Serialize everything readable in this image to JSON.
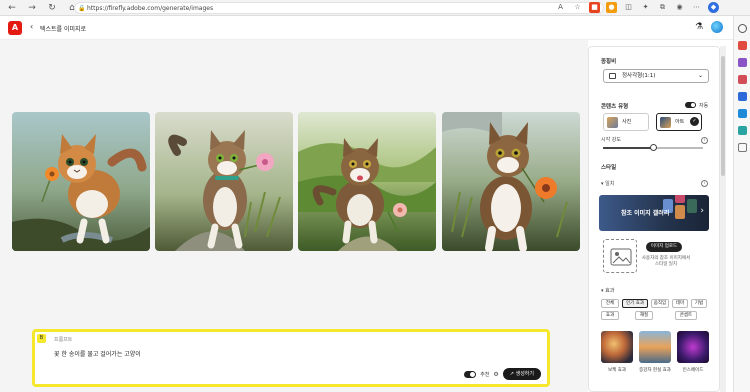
{
  "browser": {
    "url": "https://firefly.adobe.com/generate/images",
    "nav_back": "←",
    "nav_forward": "→",
    "nav_reload": "↻",
    "nav_home": "⌂",
    "lock_icon": "🔒"
  },
  "app": {
    "logo_letter": "A",
    "back_arrow": "‹",
    "title": "텍스트를 이미지로",
    "flask_icon": "⚗"
  },
  "prompt": {
    "chip": "B",
    "label": "프롬프트",
    "text": "꽃 한 송이를 물고 걸어가는 고양이",
    "toggle_label": "추천",
    "settings_icon": "⚙",
    "generate_label": "생성하기",
    "generate_icon": "↗"
  },
  "panel": {
    "aspect_label": "종횡비",
    "aspect_value": "정사각형(1:1)",
    "content_type_label": "콘텐츠 유형",
    "auto_label": "자동",
    "photo_label": "사진",
    "art_label": "아트",
    "visual_intensity_label": "시각 강도",
    "visual_intensity_value": 0.5,
    "style_label": "스타일",
    "match_label": "일치",
    "gallery_label": "참조 이미지 갤러리",
    "upload_label": "이미지 업로드",
    "upload_desc": "사용자의 참조 이미지에서 스타일 일치",
    "effects_label": "효과",
    "effect_tabs": [
      "전체",
      "인기 효과",
      "움직임",
      "테마",
      "기법",
      "효과",
      "재질",
      "콘셉트"
    ],
    "active_tab_index": 1,
    "effect_thumbs": [
      "보케 효과",
      "증강자 현실 효과",
      "인스페이드"
    ]
  },
  "colors": {
    "accent_yellow": "#f5e72c",
    "adobe_red": "#e41b13",
    "dark_button": "#1a1a1a"
  }
}
